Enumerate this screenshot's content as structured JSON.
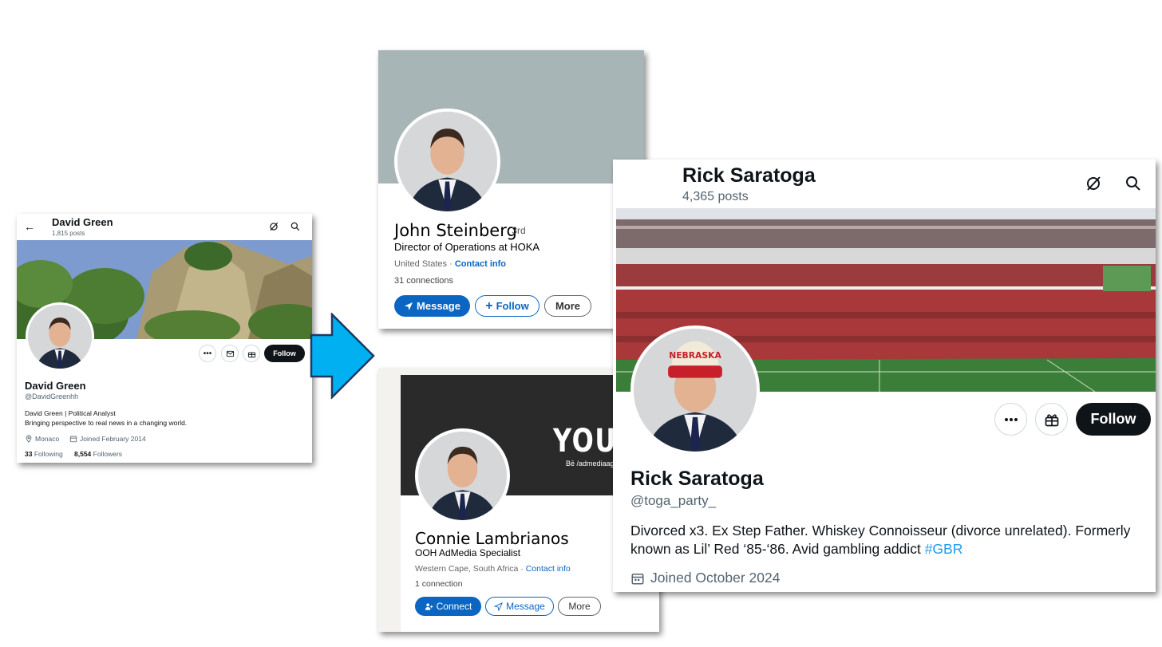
{
  "x_profile_small": {
    "header_name": "David Green",
    "header_posts": "1,815 posts",
    "follow_label": "Follow",
    "name": "David Green",
    "handle": "@DavidGreenhh",
    "bio_line1": "David Green | Political Analyst",
    "bio_line2": "Bringing perspective to real news in a changing world.",
    "location": "Monaco",
    "joined": "Joined February 2014",
    "following_count": "33",
    "following_label": "Following",
    "followers_count": "8,554",
    "followers_label": "Followers"
  },
  "linkedin_profile_1": {
    "name": "John Steinberg",
    "degree": "· 3rd",
    "title": "Director of Operations at HOKA",
    "location": "United States · ",
    "contact_info": "Contact info",
    "connections": "31 connections",
    "message_label": "Message",
    "follow_label": "Follow",
    "more_label": "More"
  },
  "linkedin_profile_2": {
    "cover_text": "YOUR M",
    "cover_subtext": "Bē /admediaagency",
    "name": "Connie Lambrianos",
    "title": "OOH AdMedia Specialist",
    "location": "Western Cape, South Africa · ",
    "contact_info": "Contact info",
    "connections": "1 connection",
    "connect_label": "Connect",
    "message_label": "Message",
    "more_label": "More"
  },
  "x_profile_large": {
    "header_name": "Rick Saratoga",
    "header_posts": "4,365 posts",
    "follow_label": "Follow",
    "name": "Rick Saratoga",
    "handle": "@toga_party_",
    "bio_text": "Divorced x3. Ex Step Father. Whiskey Connoisseur (divorce unrelated). Formerly known as Lil’ Red ‘85-‘86. Avid gambling addict ",
    "bio_hashtag": "#GBR",
    "joined": "Joined October 2024",
    "hat_text": "NEBRASKA"
  },
  "colors": {
    "x_black": "#0f1419",
    "x_gray": "#536471",
    "x_blue": "#1d9bf0",
    "linkedin_blue": "#0a66c2",
    "arrow_blue": "#00b0f0"
  }
}
